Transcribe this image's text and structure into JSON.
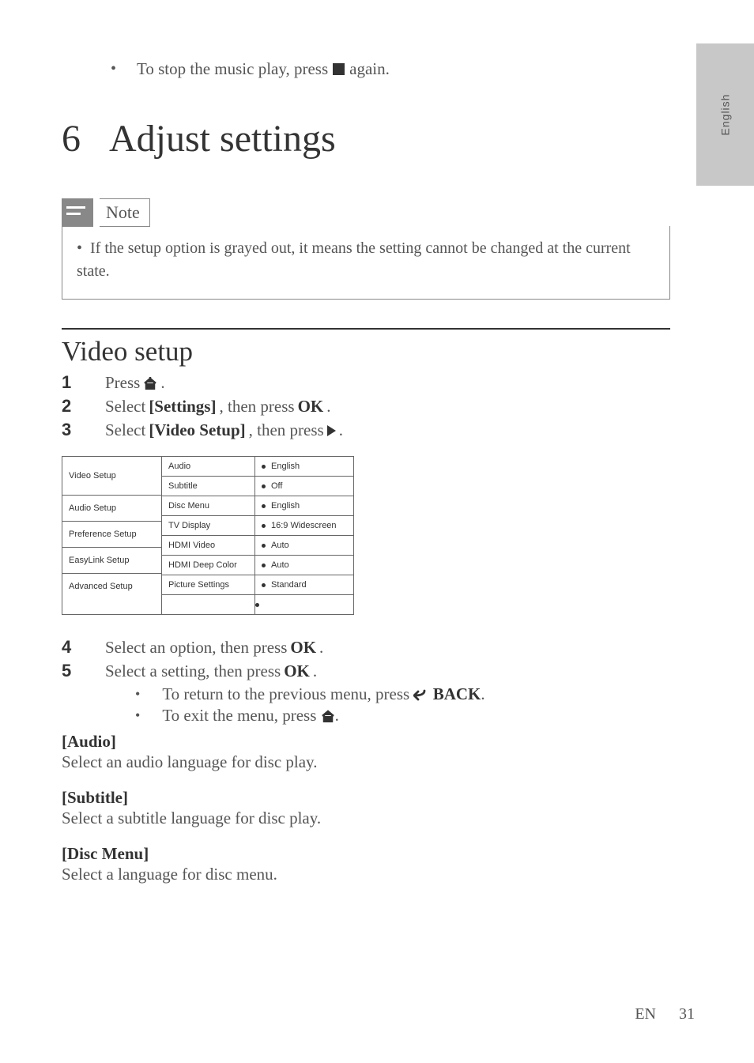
{
  "sidebar": {
    "language": "English"
  },
  "intro_bullet": {
    "prefix": "To stop the music play, press",
    "suffix": " again."
  },
  "chapter": {
    "number": "6",
    "title": "Adjust settings"
  },
  "note": {
    "label": "Note",
    "text": "If the setup option is grayed out, it means the setting cannot be changed at the current state."
  },
  "section": {
    "title": "Video setup"
  },
  "steps": {
    "s1": {
      "num": "1",
      "prefix": "Press ",
      "suffix": "."
    },
    "s2": {
      "num": "2",
      "p1": "Select ",
      "b1": "[Settings]",
      "p2": ", then press ",
      "b2": "OK",
      "p3": "."
    },
    "s3": {
      "num": "3",
      "p1": "Select ",
      "b1": "[Video Setup]",
      "p2": ", then press ",
      "p3": "."
    },
    "s4": {
      "num": "4",
      "p1": "Select an option, then press ",
      "b1": "OK",
      "p2": "."
    },
    "s5": {
      "num": "5",
      "p1": "Select a setting, then press ",
      "b1": "OK",
      "p2": "."
    }
  },
  "sub": {
    "b1": {
      "prefix": "To return to the previous menu, press ",
      "label": "BACK",
      "suffix": "."
    },
    "b2": {
      "prefix": "To exit the menu, press ",
      "suffix": "."
    }
  },
  "menu": {
    "left": [
      "Video Setup",
      "Audio Setup",
      "Preference Setup",
      "EasyLink Setup",
      "Advanced Setup"
    ],
    "mid": [
      "Audio",
      "Subtitle",
      "Disc Menu",
      "TV Display",
      "HDMI Video",
      "HDMI Deep Color",
      "Picture Settings"
    ],
    "right": [
      "English",
      "Off",
      "English",
      "16:9 Widescreen",
      "Auto",
      "Auto",
      "Standard"
    ]
  },
  "options": {
    "audio": {
      "head": "[Audio]",
      "desc": "Select an audio language for disc play."
    },
    "subtitle": {
      "head": "[Subtitle]",
      "desc": "Select a subtitle language for disc play."
    },
    "discmenu": {
      "head": "[Disc Menu]",
      "desc": "Select a language for disc menu."
    }
  },
  "footer": {
    "lang": "EN",
    "page": "31"
  }
}
